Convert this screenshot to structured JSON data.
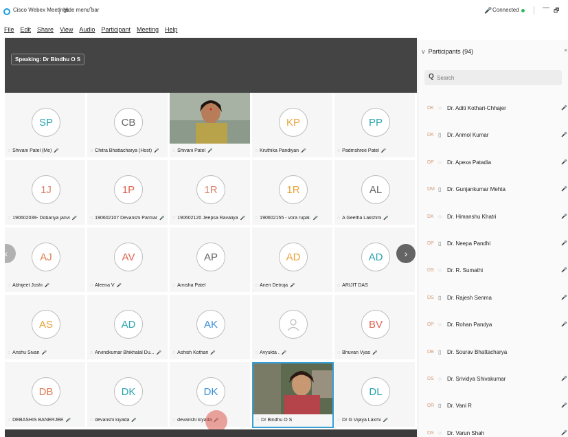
{
  "titlebar": {
    "app_title": "Cisco Webex Meetings",
    "hide_menu": "Hide menu bar",
    "hide_menu_icon": "chevron-up-icon",
    "status": "Connected",
    "status_color": "#2eb85c",
    "minimize": "—",
    "maximize": "🗗"
  },
  "menu": [
    "File",
    "Edit",
    "Share",
    "View",
    "Audio",
    "Participant",
    "Meeting",
    "Help"
  ],
  "stage": {
    "speaking": "Speaking: Dr Bindhu O S",
    "tiles": [
      {
        "initials": "SP",
        "name": "Shivani Patel (Me)",
        "color": "#2aa3b0",
        "mic": true
      },
      {
        "initials": "CB",
        "name": "Chitra Bhattacharya (Host)",
        "color": "#666666",
        "mic": true
      },
      {
        "initials": "",
        "name": "Shivani Patel",
        "color": "",
        "mic": true,
        "video": true
      },
      {
        "initials": "KP",
        "name": "Kruthika Pandiyan",
        "color": "#e8a33a",
        "mic": true
      },
      {
        "initials": "PP",
        "name": "Padmshree Patel",
        "color": "#2aa3b0",
        "mic": true
      },
      {
        "initials": "1J",
        "name": "190602039- Dobariya janvi",
        "color": "#d9836b",
        "mic": true
      },
      {
        "initials": "1P",
        "name": "190602107 Devanshi Parmar",
        "color": "#e0604f",
        "mic": true
      },
      {
        "initials": "1R",
        "name": "190602120 Jeepsa Ravaliya",
        "color": "#d9836b",
        "mic": true
      },
      {
        "initials": "1R",
        "name": "190602155 - vora rupal.",
        "color": "#e8a33a",
        "mic": true
      },
      {
        "initials": "AL",
        "name": "A Geetha Lakshmi",
        "color": "#666666",
        "mic": true
      },
      {
        "initials": "AJ",
        "name": "Abhijeet Joshi",
        "color": "#e07a4f",
        "mic": true
      },
      {
        "initials": "AV",
        "name": "Aleena V",
        "color": "#e0604f",
        "mic": true
      },
      {
        "initials": "AP",
        "name": "Amisha Patel",
        "color": "#666666",
        "mic": false
      },
      {
        "initials": "AD",
        "name": "Aneri Detroja",
        "color": "#e8a33a",
        "mic": true
      },
      {
        "initials": "AD",
        "name": "ARIJIT DAS",
        "color": "#2aa3b0",
        "mic": false
      },
      {
        "initials": "AS",
        "name": "Anshu Sivan",
        "color": "#e8a33a",
        "mic": true
      },
      {
        "initials": "AD",
        "name": "Arvindkumar Bhikhalal Du...",
        "color": "#2aa3b0",
        "mic": true
      },
      {
        "initials": "AK",
        "name": "Ashish Kothari",
        "color": "#3a8fd8",
        "mic": true
      },
      {
        "initials": "",
        "name": "Avyukta .",
        "color": "#bbbbbb",
        "mic": true,
        "placeholder": true
      },
      {
        "initials": "BV",
        "name": "Bhuvan Vyas",
        "color": "#e0604f",
        "mic": true
      },
      {
        "initials": "DB",
        "name": "DEBASHIS BANERJEE",
        "color": "#e07a4f",
        "mic": true
      },
      {
        "initials": "DK",
        "name": "devanshi kiyada",
        "color": "#2aa3b0",
        "mic": true
      },
      {
        "initials": "DK",
        "name": "devanshi kiyada",
        "color": "#3a8fd8",
        "mic": true
      },
      {
        "initials": "",
        "name": "Dr Bindhu O S",
        "color": "",
        "mic": false,
        "video": true,
        "active": true
      },
      {
        "initials": "DL",
        "name": "Dr G Vijaya Laxmi",
        "color": "#2aa3b0",
        "mic": true
      }
    ]
  },
  "participants": {
    "title": "Participants (94)",
    "search_placeholder": "Search",
    "list": [
      {
        "initials": "DK",
        "name": "Dr. Aditi Kothari-Chhajer",
        "mic": true
      },
      {
        "initials": "DK",
        "name": "Dr. Anmol Kumar",
        "mic": true
      },
      {
        "initials": "DP",
        "name": "Dr. Apexa Patadia",
        "mic": true
      },
      {
        "initials": "DM",
        "name": "Dr. Gunjankumar Mehta",
        "mic": true
      },
      {
        "initials": "DK",
        "name": "Dr. Himanshu Khatri",
        "mic": true
      },
      {
        "initials": "DP",
        "name": "Dr. Neepa Pandhi",
        "mic": true
      },
      {
        "initials": "DS",
        "name": "Dr. R. Sumathi",
        "mic": true
      },
      {
        "initials": "DS",
        "name": "Dr. Rajesh Senma",
        "mic": true
      },
      {
        "initials": "DP",
        "name": "Dr. Rohan Pandya",
        "mic": true
      },
      {
        "initials": "DB",
        "name": "Dr. Sourav Bhattacharya",
        "mic": false
      },
      {
        "initials": "DS",
        "name": "Dr. Srividya Shivakumar",
        "mic": true
      },
      {
        "initials": "DR",
        "name": "Dr. Vani R",
        "mic": true
      },
      {
        "initials": "DS",
        "name": "Dr. Varun Shah",
        "mic": true
      }
    ]
  }
}
